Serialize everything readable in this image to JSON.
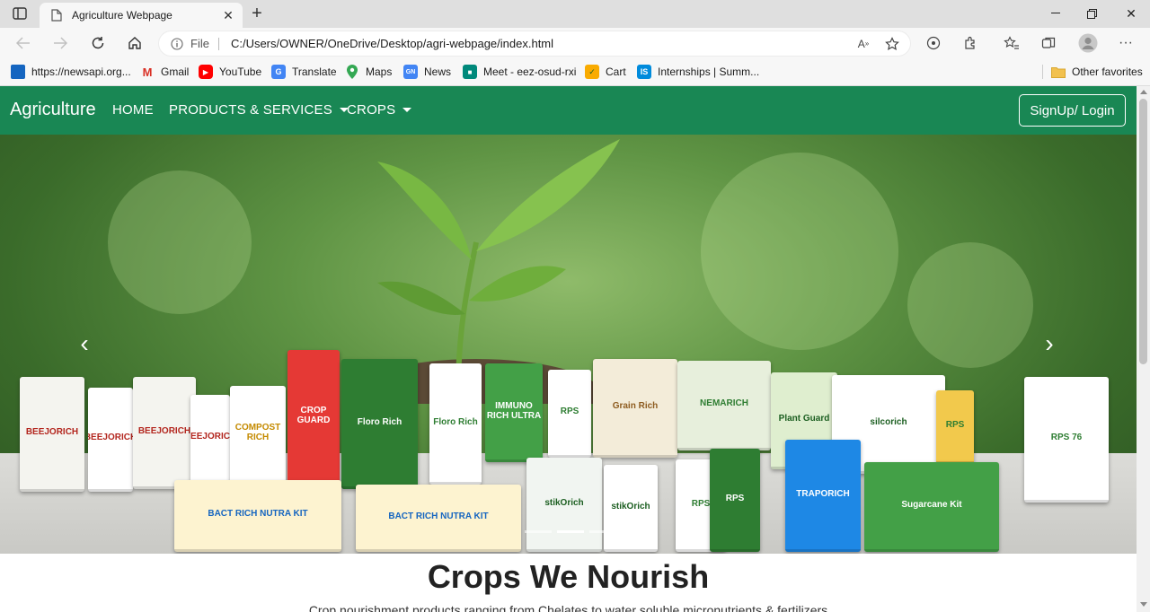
{
  "browser": {
    "tab_title": "Agriculture Webpage",
    "address": {
      "scheme_label": "File",
      "url": "C:/Users/OWNER/OneDrive/Desktop/agri-webpage/index.html"
    },
    "bookmarks": [
      {
        "label": "https://newsapi.org...",
        "icon": "newsapi-favicon",
        "color": "#1565c0"
      },
      {
        "label": "Gmail",
        "icon": "gmail-favicon",
        "color": "#d93025"
      },
      {
        "label": "YouTube",
        "icon": "youtube-favicon",
        "color": "#ff0000"
      },
      {
        "label": "Translate",
        "icon": "translate-favicon",
        "color": "#4285f4"
      },
      {
        "label": "Maps",
        "icon": "maps-favicon",
        "color": "#34a853"
      },
      {
        "label": "News",
        "icon": "news-favicon",
        "color": "#4285f4"
      },
      {
        "label": "Meet - eez-osud-rxi",
        "icon": "meet-favicon",
        "color": "#00897b"
      },
      {
        "label": "Cart",
        "icon": "cart-favicon",
        "color": "#f9ab00"
      },
      {
        "label": "Internships | Summ...",
        "icon": "internshala-favicon",
        "color": "#008bdc"
      }
    ],
    "other_favorites": "Other favorites"
  },
  "site": {
    "brand": "Agriculture",
    "nav": {
      "home": "HOME",
      "products": "PRODUCTS & SERVICES",
      "crops": "CROPS"
    },
    "signup": "SignUp/ Login",
    "theme_color": "#198754"
  },
  "carousel": {
    "prev_symbol": "‹",
    "next_symbol": "›",
    "slide_count": 3,
    "active_slide": 1,
    "products": [
      {
        "label": "BEEJORICH",
        "bg": "#f4f4ef",
        "fg": "#b3261e"
      },
      {
        "label": "BEEJORICH",
        "bg": "#ffffff",
        "fg": "#b3261e"
      },
      {
        "label": "BEEJORICH",
        "bg": "#f4f4ef",
        "fg": "#b3261e"
      },
      {
        "label": "BEEJORICH",
        "bg": "#ffffff",
        "fg": "#b3261e"
      },
      {
        "label": "COMPOST RICH",
        "bg": "#ffffff",
        "fg": "#c48a00"
      },
      {
        "label": "CROP GUARD",
        "bg": "#e53935",
        "fg": "#ffffff"
      },
      {
        "label": "Floro Rich",
        "bg": "#2e7d32",
        "fg": "#ffffff"
      },
      {
        "label": "Floro Rich",
        "bg": "#ffffff",
        "fg": "#2e7d32"
      },
      {
        "label": "IMMUNO RICH ULTRA",
        "bg": "#43a047",
        "fg": "#ffffff"
      },
      {
        "label": "RPS",
        "bg": "#ffffff",
        "fg": "#2e7d32"
      },
      {
        "label": "Grain Rich",
        "bg": "#f3ecd9",
        "fg": "#8d5b1f"
      },
      {
        "label": "NEMARICH",
        "bg": "#e7efdc",
        "fg": "#2e7d32"
      },
      {
        "label": "Plant Guard",
        "bg": "#dfeecf",
        "fg": "#1b5e20"
      },
      {
        "label": "silcorich",
        "bg": "#ffffff",
        "fg": "#1b5e20"
      },
      {
        "label": "RPS",
        "bg": "#f2c94c",
        "fg": "#2e7d32"
      },
      {
        "label": "RPS 76",
        "bg": "#ffffff",
        "fg": "#2e7d32"
      },
      {
        "label": "BACT RICH NUTRA KIT",
        "bg": "#fdf3d0",
        "fg": "#1565c0"
      },
      {
        "label": "BACT RICH NUTRA KIT",
        "bg": "#fdf3d0",
        "fg": "#1565c0"
      },
      {
        "label": "stikOrich",
        "bg": "#f1f5f1",
        "fg": "#1b5e20"
      },
      {
        "label": "stikOrich",
        "bg": "#ffffff",
        "fg": "#1b5e20"
      },
      {
        "label": "RPS",
        "bg": "#ffffff",
        "fg": "#2e7d32"
      },
      {
        "label": "RPS",
        "bg": "#2e7d32",
        "fg": "#ffffff"
      },
      {
        "label": "TRAPORICH",
        "bg": "#1e88e5",
        "fg": "#ffffff"
      },
      {
        "label": "Sugarcane Kit",
        "bg": "#43a047",
        "fg": "#ffffff"
      }
    ]
  },
  "section": {
    "title": "Crops We Nourish",
    "subtitle": "Crop nourishment products ranging from Chelates to water soluble micronutrients & fertilizers"
  }
}
